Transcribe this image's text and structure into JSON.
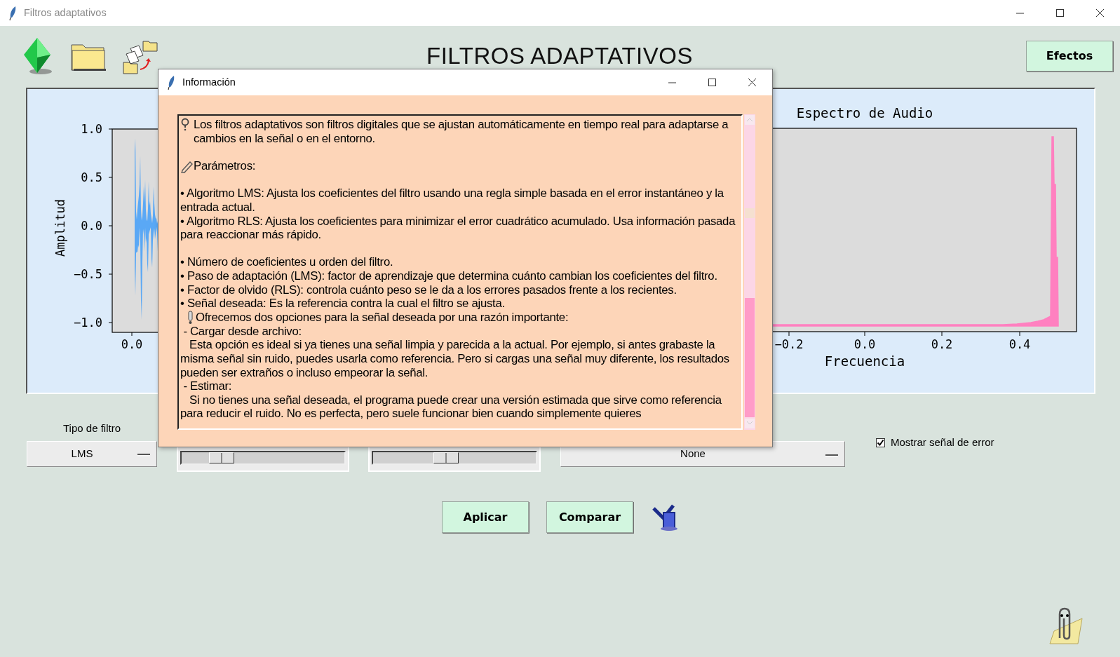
{
  "window": {
    "title": "Filtros adaptativos"
  },
  "header": {
    "title": "FILTROS ADAPTATIVOS",
    "effects_button": "Efectos"
  },
  "waveform_plot": {
    "ylabel": "Amplitud",
    "yticks": [
      "1.0",
      "0.5",
      "0.0",
      "−0.5",
      "−1.0"
    ],
    "xticks": [
      "0.0"
    ]
  },
  "spectrum_plot": {
    "title": "Espectro de Audio",
    "xlabel": "Frecuencia",
    "xticks": [
      "−0.2",
      "0.0",
      "0.2",
      "0.4"
    ]
  },
  "controls": {
    "filter_type": {
      "label": "Tipo de filtro",
      "value": "LMS"
    },
    "sliders": [
      {
        "level": 0.2
      },
      {
        "level": 0.44
      }
    ],
    "signal_dropdown": {
      "value": "None"
    },
    "show_error": {
      "label": "Mostrar señal de error",
      "checked": true
    }
  },
  "buttons": [
    "Aplicar",
    "Comparar"
  ],
  "dialog": {
    "title": "Información",
    "sections": [
      {
        "paragraphs": [
          {
            "kind": "question",
            "text": "Los filtros adaptativos son filtros digitales que se ajustan automáticamente en tiempo real para adaptarse a cambios en la señal o en el entorno."
          }
        ]
      },
      {
        "paragraphs": [
          {
            "kind": "pencil",
            "text": "Parámetros:"
          }
        ]
      },
      {
        "paragraphs": [
          {
            "kind": "plain",
            "text": "• Algoritmo LMS: Ajusta los coeficientes del filtro usando una regla simple basada en el error instantáneo y la entrada actual."
          },
          {
            "kind": "plain",
            "text": "• Algoritmo RLS: Ajusta los coeficientes para minimizar el error cuadrático acumulado. Usa información pasada para reaccionar más rápido."
          }
        ]
      },
      {
        "paragraphs": [
          {
            "kind": "plain",
            "text": "• Número de coeficientes u orden del filtro."
          },
          {
            "kind": "plain",
            "text": "• Paso de adaptación (LMS): factor de aprendizaje que determina cuánto cambian los coeficientes del filtro."
          },
          {
            "kind": "plain",
            "text": "• Factor de olvido (RLS): controla cuánto peso se le da a los errores pasados frente a los recientes."
          },
          {
            "kind": "plain",
            "text": "• Señal deseada: Es la referencia contra la cual el filtro se ajusta."
          },
          {
            "kind": "exclaim",
            "text": "Ofrecemos dos opciones para la señal deseada por una razón importante:"
          },
          {
            "kind": "plain",
            "text": " - Cargar desde archivo:"
          },
          {
            "kind": "plain",
            "text": "   Esta opción es ideal si ya tienes una señal limpia y parecida a la actual. Por ejemplo, si antes grabaste la misma señal sin ruido, puedes usarla como referencia. Pero si cargas una señal muy diferente, los resultados pueden ser extraños o incluso empeorar la señal."
          },
          {
            "kind": "plain",
            "text": " - Estimar:"
          },
          {
            "kind": "plain",
            "text": "   Si no tienes una señal deseada, el programa puede crear una versión estimada que sirve como referencia para reducir el ruido. No es perfecta, pero suele funcionar bien cuando simplemente quieres"
          }
        ]
      }
    ]
  }
}
